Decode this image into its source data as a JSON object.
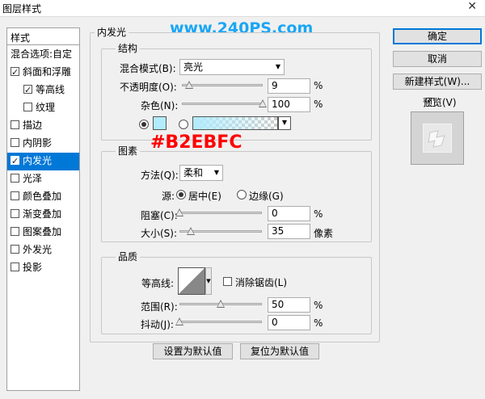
{
  "window": {
    "title": "图层样式",
    "close_glyph": "✕"
  },
  "watermark": "www.240PS.com",
  "color_note": "#B2EBFC",
  "left_panel": {
    "header": "样式",
    "items": [
      {
        "label": "混合选项:自定",
        "checkbox": false,
        "checked": false,
        "sub": false,
        "selected": false
      },
      {
        "label": "斜面和浮雕",
        "checkbox": true,
        "checked": true,
        "sub": false,
        "selected": false
      },
      {
        "label": "等高线",
        "checkbox": true,
        "checked": true,
        "sub": true,
        "selected": false
      },
      {
        "label": "纹理",
        "checkbox": true,
        "checked": false,
        "sub": true,
        "selected": false
      },
      {
        "label": "描边",
        "checkbox": true,
        "checked": false,
        "sub": false,
        "selected": false
      },
      {
        "label": "内阴影",
        "checkbox": true,
        "checked": false,
        "sub": false,
        "selected": false
      },
      {
        "label": "内发光",
        "checkbox": true,
        "checked": true,
        "sub": false,
        "selected": true
      },
      {
        "label": "光泽",
        "checkbox": true,
        "checked": false,
        "sub": false,
        "selected": false
      },
      {
        "label": "颜色叠加",
        "checkbox": true,
        "checked": false,
        "sub": false,
        "selected": false
      },
      {
        "label": "渐变叠加",
        "checkbox": true,
        "checked": false,
        "sub": false,
        "selected": false
      },
      {
        "label": "图案叠加",
        "checkbox": true,
        "checked": false,
        "sub": false,
        "selected": false
      },
      {
        "label": "外发光",
        "checkbox": true,
        "checked": false,
        "sub": false,
        "selected": false
      },
      {
        "label": "投影",
        "checkbox": true,
        "checked": false,
        "sub": false,
        "selected": false
      }
    ]
  },
  "main": {
    "section_title": "内发光",
    "structure": {
      "legend": "结构",
      "blend_mode_label": "混合模式(B):",
      "blend_mode_value": "亮光",
      "opacity_label": "不透明度(O):",
      "opacity_value": "9",
      "opacity_unit": "%",
      "opacity_fraction": 0.09,
      "noise_label": "杂色(N):",
      "noise_value": "100",
      "noise_unit": "%",
      "noise_fraction": 1.0,
      "glow_color": "#B2EBFC",
      "gradient_end_color": "#B2EBFC"
    },
    "elements": {
      "legend": "图素",
      "technique_label": "方法(Q):",
      "technique_value": "柔和",
      "source_label": "源:",
      "source_center": "居中(E)",
      "source_edge": "边缘(G)",
      "choke_label": "阻塞(C):",
      "choke_value": "0",
      "choke_unit": "%",
      "choke_fraction": 0.0,
      "size_label": "大小(S):",
      "size_value": "35",
      "size_unit": "像素",
      "size_fraction": 0.14
    },
    "quality": {
      "legend": "品质",
      "contour_label": "等高线:",
      "antialias_label": "消除锯齿(L)",
      "range_label": "范围(R):",
      "range_value": "50",
      "range_unit": "%",
      "range_fraction": 0.5,
      "jitter_label": "抖动(J):",
      "jitter_value": "0",
      "jitter_unit": "%",
      "jitter_fraction": 0.0
    },
    "make_default": "设置为默认值",
    "reset_default": "复位为默认值"
  },
  "right_panel": {
    "ok": "确定",
    "cancel": "取消",
    "new_style": "新建样式(W)...",
    "preview_label": "预览(V)",
    "preview_checked": true
  }
}
